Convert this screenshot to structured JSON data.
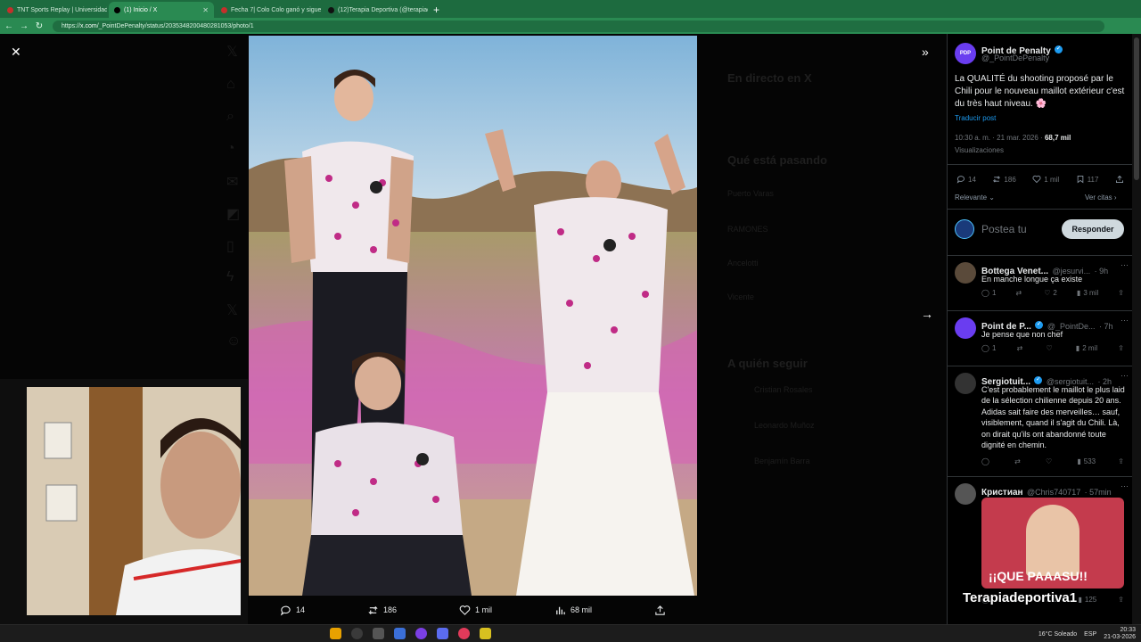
{
  "browser": {
    "tabs": [
      {
        "label": "TNT Sports Replay | Universidad d",
        "favicon_color": "#c4302b",
        "active": false
      },
      {
        "label": "(1) Inicio / X",
        "favicon_color": "#000000",
        "active": true
      },
      {
        "label": "Fecha 7| Colo Colo ganó y sigue li",
        "favicon_color": "#c4302b",
        "active": false
      },
      {
        "label": "(12)Terapia Deportiva (@terapiad",
        "favicon_color": "#111111",
        "active": false
      }
    ],
    "new_tab": "+",
    "url_prefix": "https://",
    "url_host": "x.com",
    "url_path": "/_PointDePenalty/status/2035348200480281053/photo/1"
  },
  "viewer": {
    "close": "✕",
    "collapse": "»",
    "next": "→",
    "actions": {
      "replies": "14",
      "reposts": "186",
      "likes": "1 mil",
      "views": "68 mil"
    }
  },
  "background_dimmed": {
    "live": "En directo en X",
    "trending": "Qué está pasando",
    "follow": "A quién seguir",
    "items": [
      "Puerto Varas",
      "RAMONES",
      "Ancelotti",
      "Vicente",
      "Cristian Rosales",
      "Leonardo Muñoz",
      "Benjamín Barra"
    ]
  },
  "tweet": {
    "author_name": "Point de Penalty",
    "author_handle": "@_PointDePenalty",
    "avatar_text": "PDP",
    "text": "La QUALITÉ du shooting proposé par le Chili pour le nouveau maillot extérieur c'est du très haut niveau. 🌸",
    "translate": "Traducir post",
    "time": "10:30 a. m. · 21 mar. 2026 · ",
    "views_count": "68,7 mil",
    "views_label": "Visualizaciones",
    "replies": "14",
    "reposts": "186",
    "likes": "1 mil",
    "bookmarks": "117",
    "relevance": "Relevante",
    "quotes": "Ver citas",
    "compose_placeholder": "Postea tu",
    "reply_button": "Responder"
  },
  "replies": [
    {
      "name": "Bottega Venet...",
      "handle": "@jesurvi...",
      "age": "· 9h",
      "verified": false,
      "text": "En manche longue ça existe",
      "replies": "1",
      "reposts": "",
      "likes": "2",
      "views": "3 mil"
    },
    {
      "name": "Point de P...",
      "handle": "@_PointDe...",
      "age": "· 7h",
      "verified": true,
      "text": "Je pense que non chef",
      "replies": "1",
      "reposts": "",
      "likes": "",
      "views": "2 mil"
    },
    {
      "name": "Sergiotuit...",
      "handle": "@sergiotuit...",
      "age": "· 2h",
      "verified": true,
      "text": "C'est probablement le maillot le plus laid de la sélection chilienne depuis 20 ans. Adidas sait faire des merveilles… sauf, visiblement, quand il s'agit du Chili. Là, on dirait qu'ils ont abandonné toute dignité en chemin.",
      "replies": "",
      "reposts": "",
      "likes": "",
      "views": "533"
    },
    {
      "name": "Кристиан",
      "handle": "@Chris740717",
      "age": "· 57min",
      "verified": false,
      "text": "",
      "caption": "¡¡QUE PAAASU!!",
      "replies": "",
      "reposts": "",
      "likes": "1",
      "views": "125"
    }
  ],
  "overlay_watermark": "Terapiadeportiva1",
  "taskbar": {
    "weather": "16°C  Soleado",
    "lang": "ESP",
    "time": "20:33",
    "date": "21-03-2026"
  }
}
